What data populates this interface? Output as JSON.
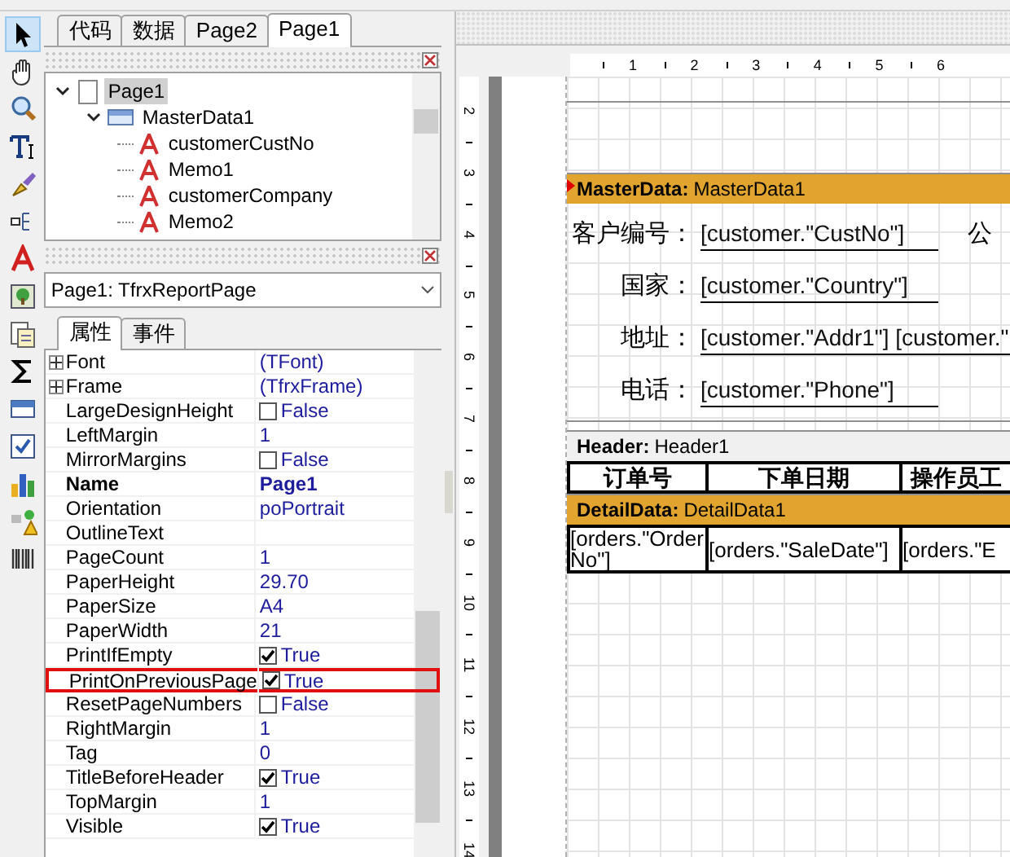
{
  "tools": [
    {
      "selected": true
    },
    {
      "selected": false
    },
    {
      "selected": false
    },
    {
      "selected": false
    },
    {
      "selected": false
    },
    {
      "selected": false
    },
    {
      "selected": false
    },
    {
      "selected": false
    },
    {
      "selected": false
    },
    {
      "selected": false
    },
    {
      "selected": false
    },
    {
      "selected": false
    },
    {
      "selected": false
    },
    {
      "selected": false
    },
    {
      "selected": false
    }
  ],
  "editor_tabs": [
    {
      "label": "代码",
      "selected": false
    },
    {
      "label": "数据",
      "selected": false
    },
    {
      "label": "Page2",
      "selected": false
    },
    {
      "label": "Page1",
      "selected": true
    }
  ],
  "tree": [
    {
      "label": "Page1",
      "kind": "page",
      "selected": true,
      "expanded": true,
      "children": [
        {
          "label": "MasterData1",
          "kind": "band",
          "selected": false,
          "expanded": true,
          "children": [
            {
              "label": "customerCustNo",
              "kind": "text",
              "selected": false
            },
            {
              "label": "Memo1",
              "kind": "text",
              "selected": false
            },
            {
              "label": "customerCompany",
              "kind": "text",
              "selected": false
            },
            {
              "label": "Memo2",
              "kind": "text",
              "selected": false
            }
          ]
        }
      ]
    }
  ],
  "object_selector": {
    "value": "Page1: TfrxReportPage"
  },
  "inspector_tabs": [
    {
      "label": "属性",
      "selected": true
    },
    {
      "label": "事件",
      "selected": false
    }
  ],
  "properties": [
    {
      "name": "Font",
      "kind": "group",
      "value": "(TFont)",
      "bold": false,
      "highlighted": false
    },
    {
      "name": "Frame",
      "kind": "group",
      "value": "(TfrxFrame)",
      "bold": false,
      "highlighted": false
    },
    {
      "name": "LargeDesignHeight",
      "kind": "bool",
      "checked": false,
      "value": "False",
      "bold": false,
      "highlighted": false
    },
    {
      "name": "LeftMargin",
      "kind": "text",
      "value": "1",
      "bold": false,
      "highlighted": false
    },
    {
      "name": "MirrorMargins",
      "kind": "bool",
      "checked": false,
      "value": "False",
      "bold": false,
      "highlighted": false
    },
    {
      "name": "Name",
      "kind": "text",
      "value": "Page1",
      "bold": true,
      "highlighted": false
    },
    {
      "name": "Orientation",
      "kind": "text",
      "value": "poPortrait",
      "bold": false,
      "highlighted": false
    },
    {
      "name": "OutlineText",
      "kind": "text",
      "bold": false,
      "highlighted": false
    },
    {
      "name": "PageCount",
      "kind": "text",
      "value": "1",
      "bold": false,
      "highlighted": false
    },
    {
      "name": "PaperHeight",
      "kind": "text",
      "value": "29.70",
      "bold": false,
      "highlighted": false
    },
    {
      "name": "PaperSize",
      "kind": "text",
      "value": "A4",
      "bold": false,
      "highlighted": false
    },
    {
      "name": "PaperWidth",
      "kind": "text",
      "value": "21",
      "bold": false,
      "highlighted": false
    },
    {
      "name": "PrintIfEmpty",
      "kind": "bool",
      "checked": true,
      "value": "True",
      "bold": false,
      "highlighted": false
    },
    {
      "name": "PrintOnPreviousPage",
      "kind": "bool",
      "checked": true,
      "value": "True",
      "bold": false,
      "highlighted": true
    },
    {
      "name": "ResetPageNumbers",
      "kind": "bool",
      "checked": false,
      "value": "False",
      "bold": false,
      "highlighted": false
    },
    {
      "name": "RightMargin",
      "kind": "text",
      "value": "1",
      "bold": false,
      "highlighted": false
    },
    {
      "name": "Tag",
      "kind": "text",
      "value": "0",
      "bold": false,
      "highlighted": false
    },
    {
      "name": "TitleBeforeHeader",
      "kind": "bool",
      "checked": true,
      "value": "True",
      "bold": false,
      "highlighted": false
    },
    {
      "name": "TopMargin",
      "kind": "text",
      "value": "1",
      "bold": false,
      "highlighted": false
    },
    {
      "name": "Visible",
      "kind": "bool",
      "checked": true,
      "value": "True",
      "bold": false,
      "highlighted": false
    }
  ],
  "ruler": {
    "horizontal": [
      "1",
      "2",
      "3",
      "4",
      "5",
      "6"
    ],
    "vertical": [
      "2",
      "3",
      "4",
      "5",
      "6",
      "7",
      "8",
      "9",
      "10",
      "11",
      "12",
      "13",
      "14"
    ]
  },
  "design": {
    "master_band": {
      "type": "MasterData:",
      "name": "MasterData1"
    },
    "fields": [
      {
        "label": "客户编号：",
        "value": "[customer.\"CustNo\"]",
        "side_label": "公"
      },
      {
        "label": "国家：",
        "value": "[customer.\"Country\"]"
      },
      {
        "label": "地址：",
        "value": "[customer.\"Addr1\"] [customer.\""
      },
      {
        "label": "电话：",
        "value": "[customer.\"Phone\"]"
      }
    ],
    "header_band": {
      "type": "Header:",
      "name": "Header1"
    },
    "columns": [
      "订单号",
      "下单日期",
      "操作员工"
    ],
    "detail_band": {
      "type": "DetailData:",
      "name": "DetailData1"
    },
    "detail_cells": [
      "[orders.\"OrderNo\"]",
      "[orders.\"SaleDate\"]",
      "[orders.\"E"
    ]
  }
}
